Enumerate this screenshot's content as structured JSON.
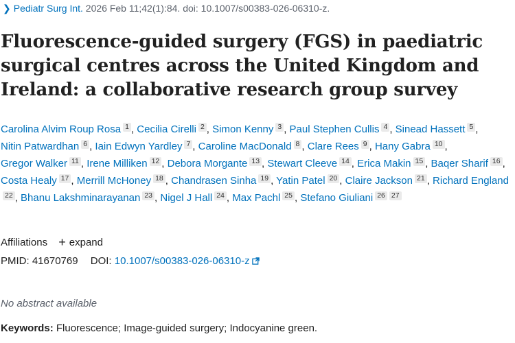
{
  "citation": {
    "journal": "Pediatr Surg Int.",
    "details": "2026 Feb 11;42(1):84. doi: 10.1007/s00383-026-06310-z."
  },
  "title": "Fluorescence-guided surgery (FGS) in paediatric surgical centres across the United Kingdom and Ireland: a collaborative research group survey",
  "authors": [
    {
      "name": "Carolina Alvim Roup Rosa",
      "sups": [
        "1"
      ]
    },
    {
      "name": "Cecilia Cirelli",
      "sups": [
        "2"
      ]
    },
    {
      "name": "Simon Kenny",
      "sups": [
        "3"
      ]
    },
    {
      "name": "Paul Stephen Cullis",
      "sups": [
        "4"
      ]
    },
    {
      "name": "Sinead Hassett",
      "sups": [
        "5"
      ]
    },
    {
      "name": "Nitin Patwardhan",
      "sups": [
        "6"
      ]
    },
    {
      "name": "Iain Edwyn Yardley",
      "sups": [
        "7"
      ]
    },
    {
      "name": "Caroline MacDonald",
      "sups": [
        "8"
      ]
    },
    {
      "name": "Clare Rees",
      "sups": [
        "9"
      ]
    },
    {
      "name": "Hany Gabra",
      "sups": [
        "10"
      ]
    },
    {
      "name": "Gregor Walker",
      "sups": [
        "11"
      ]
    },
    {
      "name": "Irene Milliken",
      "sups": [
        "12"
      ]
    },
    {
      "name": "Debora Morgante",
      "sups": [
        "13"
      ]
    },
    {
      "name": "Stewart Cleeve",
      "sups": [
        "14"
      ]
    },
    {
      "name": "Erica Makin",
      "sups": [
        "15"
      ]
    },
    {
      "name": "Baqer Sharif",
      "sups": [
        "16"
      ]
    },
    {
      "name": "Costa Healy",
      "sups": [
        "17"
      ]
    },
    {
      "name": "Merrill McHoney",
      "sups": [
        "18"
      ]
    },
    {
      "name": "Chandrasen Sinha",
      "sups": [
        "19"
      ]
    },
    {
      "name": "Yatin Patel",
      "sups": [
        "20"
      ]
    },
    {
      "name": "Claire Jackson",
      "sups": [
        "21"
      ]
    },
    {
      "name": "Richard England",
      "sups": [
        "22"
      ]
    },
    {
      "name": "Bhanu Lakshminarayanan",
      "sups": [
        "23"
      ]
    },
    {
      "name": "Nigel J Hall",
      "sups": [
        "24"
      ]
    },
    {
      "name": "Max Pachl",
      "sups": [
        "25"
      ]
    },
    {
      "name": "Stefano Giuliani",
      "sups": [
        "26",
        "27"
      ]
    }
  ],
  "affiliations": {
    "label": "Affiliations",
    "expand_label": "expand"
  },
  "ids": {
    "pmid_label": "PMID:",
    "pmid": "41670769",
    "doi_label": "DOI:",
    "doi": "10.1007/s00383-026-06310-z"
  },
  "abstract_note": "No abstract available",
  "keywords": {
    "label": "Keywords:",
    "text": "Fluorescence; Image-guided surgery; Indocyanine green."
  },
  "colors": {
    "link": "#0071bc",
    "text": "#212121",
    "muted": "#5b616b"
  }
}
